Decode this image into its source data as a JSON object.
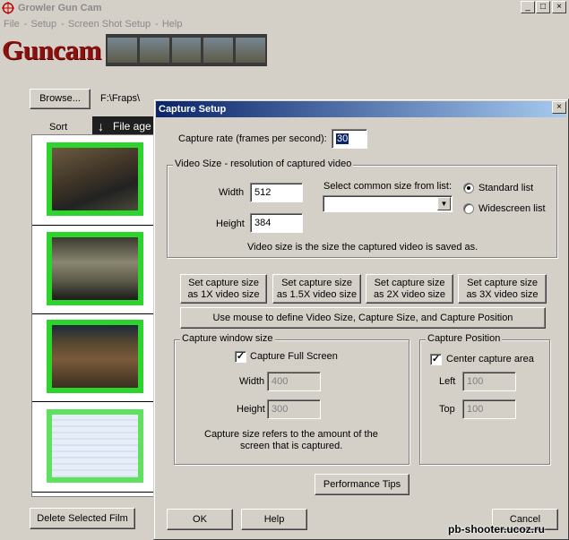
{
  "app": {
    "title": "Growler Gun Cam",
    "menu": [
      "File",
      "Setup",
      "Screen Shot Setup",
      "Help"
    ],
    "logo": "Guncam",
    "browse_label": "Browse...",
    "path": "F:\\Fraps\\",
    "sort_label": "Sort",
    "file_age_label": "File age",
    "delete_label": "Delete Selected Film",
    "window_buttons": {
      "minimize": "_",
      "maximize": "□",
      "close": "×"
    }
  },
  "dialog": {
    "title": "Capture Setup",
    "close": "×",
    "capture_rate_label": "Capture rate (frames per second):",
    "capture_rate_value": "30",
    "video_size_group": "Video Size - resolution of captured video",
    "width_label": "Width",
    "width_value": "512",
    "height_label": "Height",
    "height_value": "384",
    "common_size_label": "Select common size from list:",
    "common_size_value": "",
    "standard_list": "Standard list",
    "widescreen_list": "Widescreen list",
    "video_size_note": "Video size is the size the captured video is saved as.",
    "set_1x": [
      "Set capture size",
      "as 1X video size"
    ],
    "set_15x": [
      "Set capture size",
      "as 1.5X video size"
    ],
    "set_2x": [
      "Set capture size",
      "as 2X video size"
    ],
    "set_3x": [
      "Set capture size",
      "as 3X video size"
    ],
    "mouse_define": "Use mouse to define Video Size, Capture Size, and Capture Position",
    "capture_window_group": "Capture window size",
    "full_screen": "Capture Full Screen",
    "cw_width_label": "Width",
    "cw_width_value": "400",
    "cw_height_label": "Height",
    "cw_height_value": "300",
    "capture_note": [
      "Capture size refers to the amount of the",
      "screen that is captured."
    ],
    "capture_position_group": "Capture Position",
    "center_area": "Center capture area",
    "left_label": "Left",
    "left_value": "100",
    "top_label": "Top",
    "top_value": "100",
    "performance_tips": "Performance Tips",
    "ok": "OK",
    "help": "Help",
    "cancel": "Cancel"
  },
  "watermark": "pb-shooter.ucoz.ru",
  "colors": {
    "title_bar": "#0a246a",
    "thumb_border": "#2cd42c",
    "logo": "#8b1010"
  }
}
